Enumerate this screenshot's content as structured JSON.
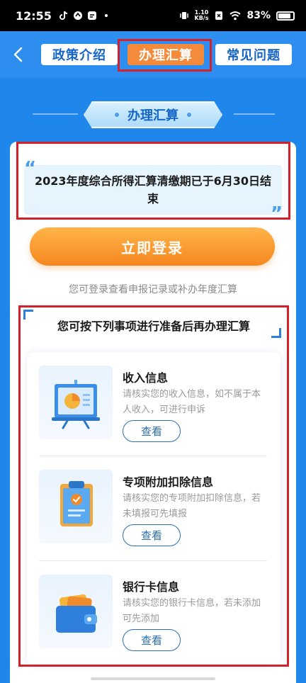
{
  "status_bar": {
    "time": "12:55",
    "net_speed_value": "1.10",
    "net_speed_unit": "KB/s",
    "battery": "83%"
  },
  "header": {
    "tabs": [
      {
        "label": "政策介绍",
        "active": false
      },
      {
        "label": "办理汇算",
        "active": true
      },
      {
        "label": "常见问题",
        "active": false
      }
    ]
  },
  "section_title": "办理汇算",
  "notice": {
    "text": "2023年度综合所得汇算清缴期已于6月30日结束"
  },
  "login": {
    "button_label": "立即登录",
    "hint": "您可登录查看申报记录或补办年度汇算"
  },
  "prep": {
    "title": "您可按下列事项进行准备后再办理汇算",
    "items": [
      {
        "title": "收入信息",
        "desc": "请核实您的收入信息，如不属于本人收入，可进行申诉",
        "button": "查看",
        "icon": "presentation-chart-icon"
      },
      {
        "title": "专项附加扣除信息",
        "desc": "请核实您的专项附加扣除信息，若未填报可先填报",
        "button": "查看",
        "icon": "clipboard-check-icon"
      },
      {
        "title": "银行卡信息",
        "desc": "请核实您的银行卡信息，若未添加可先添加",
        "button": "查看",
        "icon": "wallet-icon"
      }
    ]
  },
  "colors": {
    "primary_blue": "#1f86ec",
    "accent_orange": "#f5871f",
    "highlight_red": "#d3202a"
  }
}
